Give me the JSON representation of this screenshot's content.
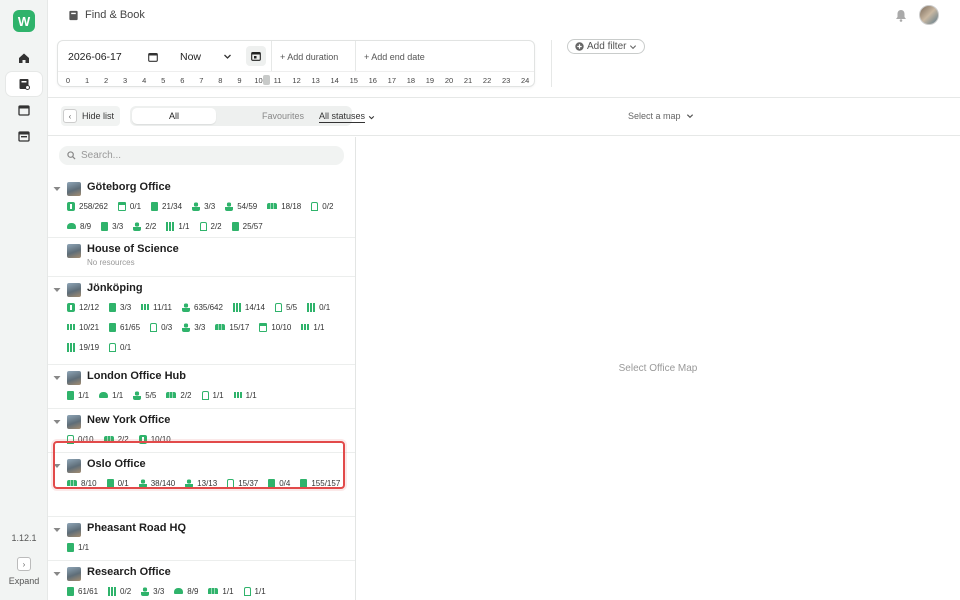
{
  "app": {
    "logo_letter": "W",
    "version": "1.12.1",
    "expand_label": "Expand",
    "expand_glyph": "›",
    "accent": "#2fb36b"
  },
  "header": {
    "title": "Find & Book"
  },
  "date_filter": {
    "date": "2026-06-17",
    "time": "Now",
    "add_duration": "+  Add duration",
    "add_end_date": "+  Add end date",
    "hours": [
      "0",
      "1",
      "2",
      "3",
      "4",
      "5",
      "6",
      "7",
      "8",
      "9",
      "10",
      "11",
      "12",
      "13",
      "14",
      "15",
      "16",
      "17",
      "18",
      "19",
      "20",
      "21",
      "22",
      "23",
      "24"
    ]
  },
  "add_filter": "Add filter",
  "toolbar": {
    "hide_list": "Hide list",
    "hide_glyph": "‹",
    "tab_all": "All",
    "tab_favourites": "Favourites",
    "statuses": "All statuses",
    "select_map": "Select a map"
  },
  "search": {
    "placeholder": "Search..."
  },
  "offices": [
    {
      "name": "Göteborg Office",
      "subtitle": "",
      "resources": [
        {
          "icon": "p",
          "value": "258/262"
        },
        {
          "icon": "desk",
          "value": "0/1"
        },
        {
          "icon": "room",
          "value": "21/34"
        },
        {
          "icon": "person",
          "value": "3/3"
        },
        {
          "icon": "person",
          "value": "54/59"
        },
        {
          "icon": "crowd",
          "value": "18/18"
        },
        {
          "icon": "door",
          "value": "0/2"
        },
        {
          "icon": "car",
          "value": "8/9"
        },
        {
          "icon": "room",
          "value": "3/3"
        },
        {
          "icon": "person",
          "value": "2/2"
        },
        {
          "icon": "grid",
          "value": "1/1"
        },
        {
          "icon": "door",
          "value": "2/2"
        },
        {
          "icon": "room",
          "value": "25/57"
        }
      ]
    },
    {
      "name": "House of Science",
      "subtitle": "No resources",
      "resources": []
    },
    {
      "name": "Jönköping",
      "subtitle": "",
      "resources": [
        {
          "icon": "p",
          "value": "12/12"
        },
        {
          "icon": "room",
          "value": "3/3"
        },
        {
          "icon": "bar",
          "value": "11/11"
        },
        {
          "icon": "person",
          "value": "635/642"
        },
        {
          "icon": "grid",
          "value": "14/14"
        },
        {
          "icon": "door",
          "value": "5/5"
        },
        {
          "icon": "grid",
          "value": "0/1"
        },
        {
          "icon": "bar",
          "value": "10/21"
        },
        {
          "icon": "room",
          "value": "61/65"
        },
        {
          "icon": "door",
          "value": "0/3"
        },
        {
          "icon": "person",
          "value": "3/3"
        },
        {
          "icon": "crowd",
          "value": "15/17"
        },
        {
          "icon": "desk",
          "value": "10/10"
        },
        {
          "icon": "bar",
          "value": "1/1"
        },
        {
          "icon": "grid",
          "value": "19/19"
        },
        {
          "icon": "door",
          "value": "0/1"
        }
      ]
    },
    {
      "name": "London Office Hub",
      "subtitle": "",
      "resources": [
        {
          "icon": "room",
          "value": "1/1"
        },
        {
          "icon": "car",
          "value": "1/1"
        },
        {
          "icon": "person",
          "value": "5/5"
        },
        {
          "icon": "crowd",
          "value": "2/2"
        },
        {
          "icon": "door",
          "value": "1/1"
        },
        {
          "icon": "bar",
          "value": "1/1"
        }
      ]
    },
    {
      "name": "New York Office",
      "subtitle": "",
      "resources": [
        {
          "icon": "door",
          "value": "0/10"
        },
        {
          "icon": "crowd",
          "value": "2/2"
        },
        {
          "icon": "p",
          "value": "10/10"
        }
      ]
    },
    {
      "name": "Oslo Office",
      "subtitle": "",
      "resources": [
        {
          "icon": "crowd",
          "value": "8/10"
        },
        {
          "icon": "room",
          "value": "0/1"
        },
        {
          "icon": "person",
          "value": "38/140"
        },
        {
          "icon": "person",
          "value": "13/13"
        },
        {
          "icon": "door",
          "value": "15/37"
        },
        {
          "icon": "room",
          "value": "0/4"
        },
        {
          "icon": "room",
          "value": "155/157"
        }
      ]
    },
    {
      "name": "Pheasant Road HQ",
      "subtitle": "",
      "resources": [
        {
          "icon": "room",
          "value": "1/1"
        }
      ]
    },
    {
      "name": "Research Office",
      "subtitle": "",
      "resources": [
        {
          "icon": "room",
          "value": "61/61"
        },
        {
          "icon": "grid",
          "value": "0/2"
        },
        {
          "icon": "person",
          "value": "3/3"
        },
        {
          "icon": "car",
          "value": "8/9"
        },
        {
          "icon": "crowd",
          "value": "1/1"
        },
        {
          "icon": "door",
          "value": "1/1"
        }
      ]
    }
  ],
  "map": {
    "empty_text": "Select Office Map"
  }
}
